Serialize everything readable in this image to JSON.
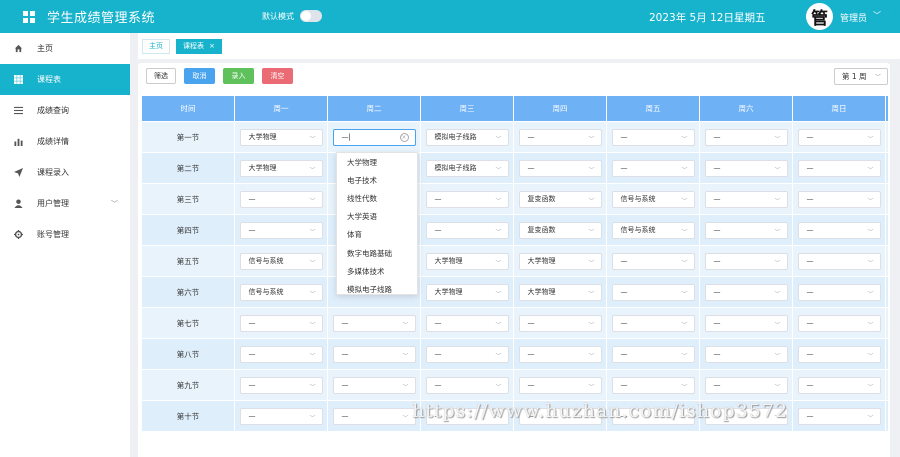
{
  "header": {
    "title": "学生成绩管理系统",
    "dark_mode_label": "默认模式",
    "date": "2023年 5月 12日",
    "weekday": "星期五",
    "avatar_char": "管",
    "user": "管理员"
  },
  "sidebar": {
    "items": [
      {
        "label": "主页",
        "icon": "home-icon"
      },
      {
        "label": "课程表",
        "icon": "grid-icon"
      },
      {
        "label": "成绩查询",
        "icon": "list-icon"
      },
      {
        "label": "成绩详情",
        "icon": "bar-chart-icon"
      },
      {
        "label": "课程录入",
        "icon": "send-icon"
      },
      {
        "label": "用户管理",
        "icon": "user-icon"
      },
      {
        "label": "账号管理",
        "icon": "gear-icon"
      }
    ]
  },
  "tabs": [
    {
      "label": "主页"
    },
    {
      "label": "课程表"
    }
  ],
  "toolbar": {
    "filter": "筛选",
    "cancel": "取消",
    "enter": "录入",
    "clear": "清空"
  },
  "week_select": "第 1 周",
  "table": {
    "headers": [
      "时间",
      "周一",
      "周二",
      "周三",
      "周四",
      "周五",
      "周六",
      "周日"
    ],
    "rows": [
      {
        "period": "第一节",
        "cells": [
          "大学物理",
          "—|",
          "模拟电子线路",
          "—",
          "—",
          "—",
          "—"
        ]
      },
      {
        "period": "第二节",
        "cells": [
          "大学物理",
          "",
          "模拟电子线路",
          "—",
          "—",
          "—",
          "—"
        ]
      },
      {
        "period": "第三节",
        "cells": [
          "—",
          "",
          "—",
          "复变函数",
          "信号与系统",
          "—",
          "—"
        ]
      },
      {
        "period": "第四节",
        "cells": [
          "—",
          "",
          "—",
          "复变函数",
          "信号与系统",
          "—",
          "—"
        ]
      },
      {
        "period": "第五节",
        "cells": [
          "信号与系统",
          "",
          "大学物理",
          "大学物理",
          "—",
          "—",
          "—"
        ]
      },
      {
        "period": "第六节",
        "cells": [
          "信号与系统",
          "",
          "大学物理",
          "大学物理",
          "—",
          "—",
          "—"
        ]
      },
      {
        "period": "第七节",
        "cells": [
          "—",
          "—",
          "—",
          "—",
          "—",
          "—",
          "—"
        ]
      },
      {
        "period": "第八节",
        "cells": [
          "—",
          "—",
          "—",
          "—",
          "—",
          "—",
          "—"
        ]
      },
      {
        "period": "第九节",
        "cells": [
          "—",
          "—",
          "—",
          "—",
          "—",
          "—",
          "—"
        ]
      },
      {
        "period": "第十节",
        "cells": [
          "—",
          "—",
          "—",
          "—",
          "—",
          "—",
          "—"
        ]
      }
    ]
  },
  "dropdown_options": [
    "大学物理",
    "电子技术",
    "线性代数",
    "大学英语",
    "体育",
    "数字电路基础",
    "多媒体技术",
    "模拟电子线路"
  ],
  "watermark": "https://www.huzhan.com/ishop3572",
  "colors": {
    "primary": "#17b3cc",
    "table_header": "#6fb1f5",
    "cancel": "#4aa3ef",
    "enter": "#5ec15b",
    "clear": "#ea6b74"
  }
}
